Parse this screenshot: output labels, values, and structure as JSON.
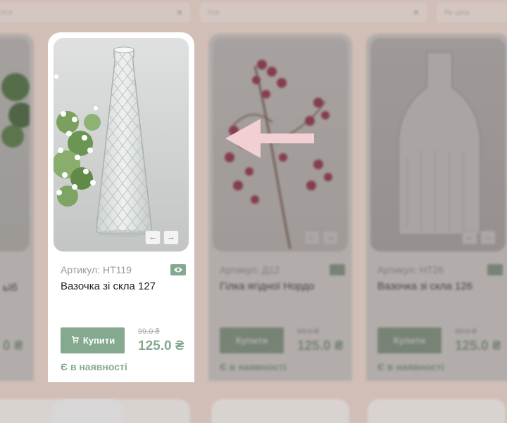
{
  "filters": [
    {
      "label": "Уся",
      "clear": "✕"
    },
    {
      "label": "Усе",
      "clear": "✕"
    },
    {
      "label": "Як ціна",
      "clear": ""
    }
  ],
  "focus_card": {
    "sku": "Артикул: НТ119",
    "title": "Вазочка зі скла 127",
    "buy_label": "Купити",
    "old_price": "99.0 ₴",
    "price": "125.0 ₴",
    "stock": "Є в наявності",
    "prev_icon": "arrow-left-icon",
    "next_icon": "arrow-right-icon",
    "badge_icon": "eye-icon"
  },
  "card_2": {
    "sku": "Артикул: Д12",
    "title": "Гілка ягідної Нордо",
    "buy_label": "Купити",
    "old_price": "99.0 ₴",
    "price": "125.0 ₴",
    "stock": "Є в наявності"
  },
  "card_3": {
    "sku": "Артикул: НТ26",
    "title": "Вазочка зі скла 126",
    "buy_label": "Купити",
    "old_price": "99.0 ₴",
    "price": "125.0 ₴",
    "stock": "Є в наявності"
  },
  "card_0": {
    "price": "0 ₴",
    "title": "ьїб"
  },
  "colors": {
    "accent": "#84a98e",
    "pointer_arrow": "#f2cfd3",
    "background": "#ecd7ce"
  },
  "pointer": "arrow-left-icon"
}
